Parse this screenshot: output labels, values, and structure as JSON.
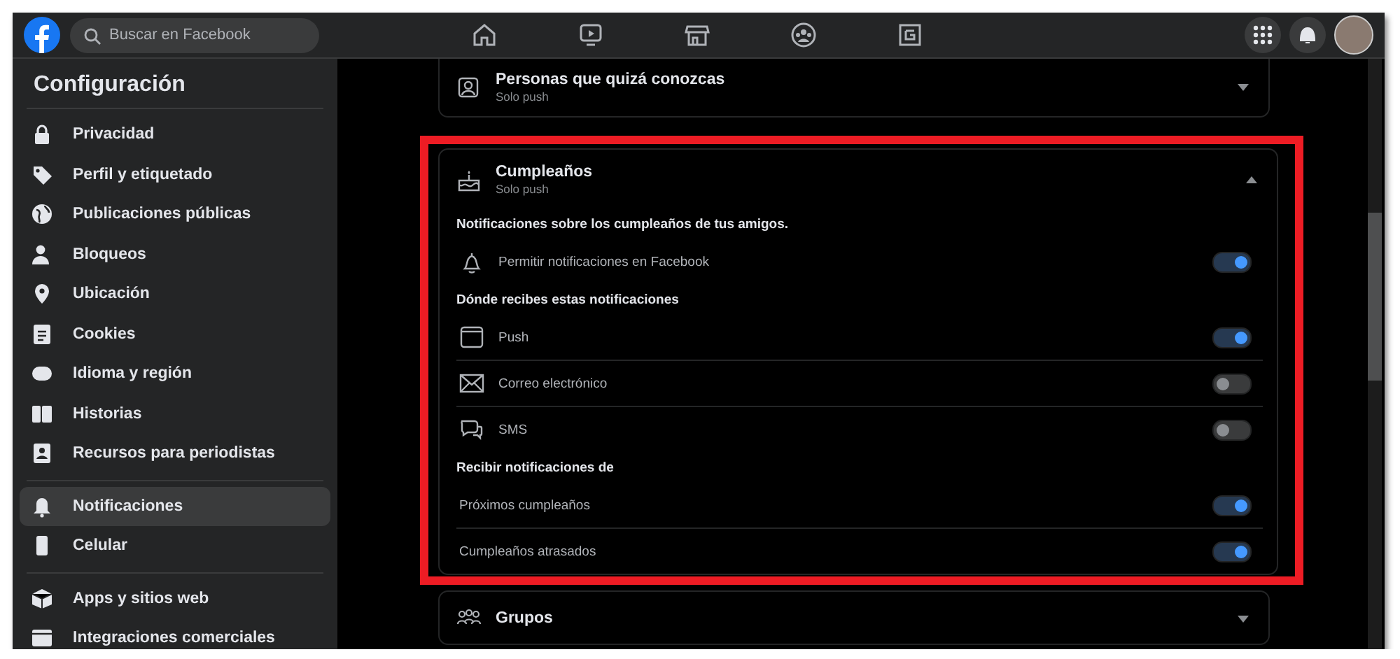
{
  "top_bar": {
    "search": {
      "placeholder": "Buscar en Facebook"
    }
  },
  "sidebar": {
    "title": "Configuración",
    "groups": [
      {
        "items": [
          {
            "label": "Privacidad",
            "selected": false
          },
          {
            "label": "Perfil y etiquetado",
            "selected": false
          },
          {
            "label": "Publicaciones públicas",
            "selected": false
          },
          {
            "label": "Bloqueos",
            "selected": false
          },
          {
            "label": "Ubicación",
            "selected": false
          },
          {
            "label": "Cookies",
            "selected": false
          },
          {
            "label": "Idioma y región",
            "selected": false
          },
          {
            "label": "Historias",
            "selected": false
          },
          {
            "label": "Recursos para periodistas",
            "selected": false
          }
        ]
      },
      {
        "items": [
          {
            "label": "Notificaciones",
            "selected": true
          },
          {
            "label": "Celular",
            "selected": false
          }
        ]
      },
      {
        "items": [
          {
            "label": "Apps y sitios web",
            "selected": false
          },
          {
            "label": "Integraciones comerciales",
            "selected": false
          }
        ]
      }
    ]
  },
  "cards": [
    {
      "title": "Personas que quizá conozcas",
      "subtitle": "Solo push",
      "expanded": false,
      "highlighted": false
    },
    {
      "title": "Cumpleaños",
      "subtitle": "Solo push",
      "expanded": true,
      "highlighted": true,
      "rows": [
        {
          "kind": "heading",
          "label": "Notificaciones sobre los cumpleaños de tus amigos."
        },
        {
          "kind": "toggle",
          "label": "Permitir notificaciones en Facebook",
          "on": true
        },
        {
          "kind": "heading",
          "label": "Dónde recibes estas notificaciones"
        },
        {
          "kind": "toggle",
          "label": "Push",
          "on": true
        },
        {
          "kind": "toggle",
          "label": "Correo electrónico",
          "on": false
        },
        {
          "kind": "toggle",
          "label": "SMS",
          "on": false
        },
        {
          "kind": "heading",
          "label": "Recibir notificaciones de"
        },
        {
          "kind": "plain-toggle",
          "label": "Próximos cumpleaños",
          "on": true
        },
        {
          "kind": "plain-toggle",
          "label": "Cumpleaños atrasados",
          "on": true
        }
      ]
    },
    {
      "title": "Grupos",
      "expanded": false,
      "highlighted": false
    }
  ]
}
